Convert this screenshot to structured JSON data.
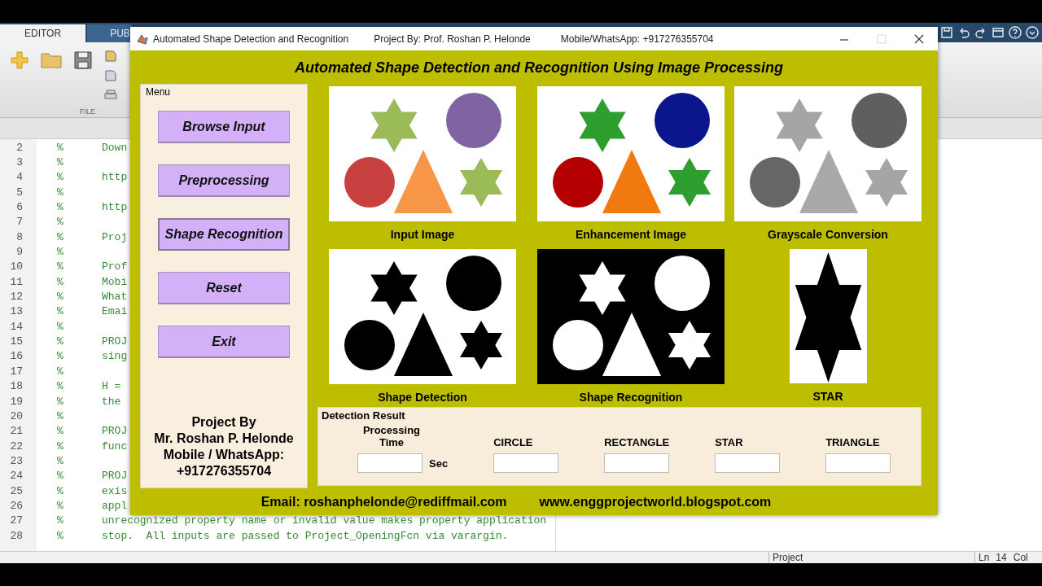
{
  "editor": {
    "tabs": [
      {
        "label": "EDITOR",
        "selected": true
      },
      {
        "label": "PUB",
        "selected": false
      }
    ],
    "section_label": "FILE",
    "lines": [
      {
        "number": "2",
        "marker": "%",
        "code": "Down"
      },
      {
        "number": "3",
        "marker": "%"
      },
      {
        "number": "4",
        "marker": "%",
        "code": "http"
      },
      {
        "number": "5",
        "marker": "%"
      },
      {
        "number": "6",
        "marker": "%",
        "code": "http"
      },
      {
        "number": "7",
        "marker": "%"
      },
      {
        "number": "8",
        "marker": "%",
        "code": "Proj"
      },
      {
        "number": "9",
        "marker": "%"
      },
      {
        "number": "10",
        "marker": "%",
        "code": "Prof"
      },
      {
        "number": "11",
        "marker": "%",
        "code": "Mobi"
      },
      {
        "number": "12",
        "marker": "%",
        "code": "What"
      },
      {
        "number": "13",
        "marker": "%",
        "code": "Emai"
      },
      {
        "number": "14",
        "marker": "%"
      },
      {
        "number": "15",
        "marker": "%",
        "code": "PROJ"
      },
      {
        "number": "16",
        "marker": "%",
        "code": "sing"
      },
      {
        "number": "17",
        "marker": "%"
      },
      {
        "number": "18",
        "marker": "%",
        "code": "H ="
      },
      {
        "number": "19",
        "marker": "%",
        "code": "the"
      },
      {
        "number": "20",
        "marker": "%"
      },
      {
        "number": "21",
        "marker": "%",
        "code": "PROJ"
      },
      {
        "number": "22",
        "marker": "%",
        "code": "func"
      },
      {
        "number": "23",
        "marker": "%"
      },
      {
        "number": "24",
        "marker": "%",
        "code": "PROJ"
      },
      {
        "number": "25",
        "marker": "%",
        "code": "exis"
      },
      {
        "number": "26",
        "marker": "%",
        "code": "appl"
      },
      {
        "number": "27",
        "marker": "%",
        "code": "unrecognized property name or invalid value makes property application"
      },
      {
        "number": "28",
        "marker": "%",
        "code": "stop.  All inputs are passed to Project_OpeningFcn via varargin."
      }
    ]
  },
  "status_bar": {
    "context": "Project",
    "line_label": "Ln",
    "line": "14",
    "col_label": "Col"
  },
  "figure": {
    "title": "Automated Shape Detection and Recognition",
    "author": "Project By: Prof. Roshan P. Helonde",
    "contact": "Mobile/WhatsApp: +917276355704",
    "heading": "Automated Shape Detection and Recognition Using Image Processing",
    "menu": {
      "title": "Menu",
      "buttons": [
        {
          "label": "Browse Input",
          "focused": false
        },
        {
          "label": "Preprocessing",
          "focused": false
        },
        {
          "label": "Shape Recognition",
          "focused": true
        },
        {
          "label": "Reset",
          "focused": false
        },
        {
          "label": "Exit",
          "focused": false
        }
      ],
      "credit": "Project By\nMr. Roshan P. Helonde\nMobile / WhatsApp:\n+917276355704"
    },
    "images": [
      {
        "kind": "color",
        "caption": "Input Image"
      },
      {
        "kind": "enhanced",
        "caption": "Enhancement Image"
      },
      {
        "kind": "gray",
        "caption": "Grayscale Conversion"
      },
      {
        "kind": "binary",
        "caption": "Shape Detection"
      },
      {
        "kind": "inverted",
        "caption": "Shape Recognition"
      },
      {
        "kind": "single-star",
        "caption": "STAR"
      }
    ],
    "detection": {
      "title": "Detection Result",
      "fields": [
        {
          "label": "Processing Time",
          "unit": "Sec"
        },
        {
          "label": "CIRCLE"
        },
        {
          "label": "RECTANGLE"
        },
        {
          "label": "STAR"
        },
        {
          "label": "TRIANGLE"
        }
      ]
    },
    "footer": [
      "Email: roshanphelonde@rediffmail.com",
      "www.enggprojectworld.blogspot.com"
    ]
  }
}
